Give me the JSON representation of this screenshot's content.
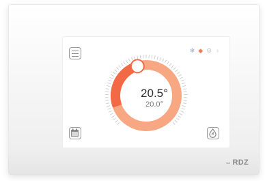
{
  "thermostat": {
    "current_temp": "20.5°",
    "set_temp": "20.0°",
    "brand": "RDZ",
    "brand_mark": "⇔"
  },
  "status_icons": [
    {
      "name": "snowflake-icon",
      "glyph": "❄",
      "color": "#9aa7c4"
    },
    {
      "name": "heating-diamond-icon",
      "glyph": "◆",
      "color": "#f07b5a"
    },
    {
      "name": "fan-icon",
      "glyph": "⚙",
      "color": "#c7c7c7"
    },
    {
      "name": "humidity-drop-icon",
      "glyph": "♁",
      "color": "#c7c7c7"
    }
  ],
  "dial": {
    "level_fraction": 0.52,
    "colors": {
      "dark": "#f26a45",
      "light": "#f7a882",
      "ticks": "#cfcfcf",
      "knob_border": "#f26a45"
    }
  }
}
